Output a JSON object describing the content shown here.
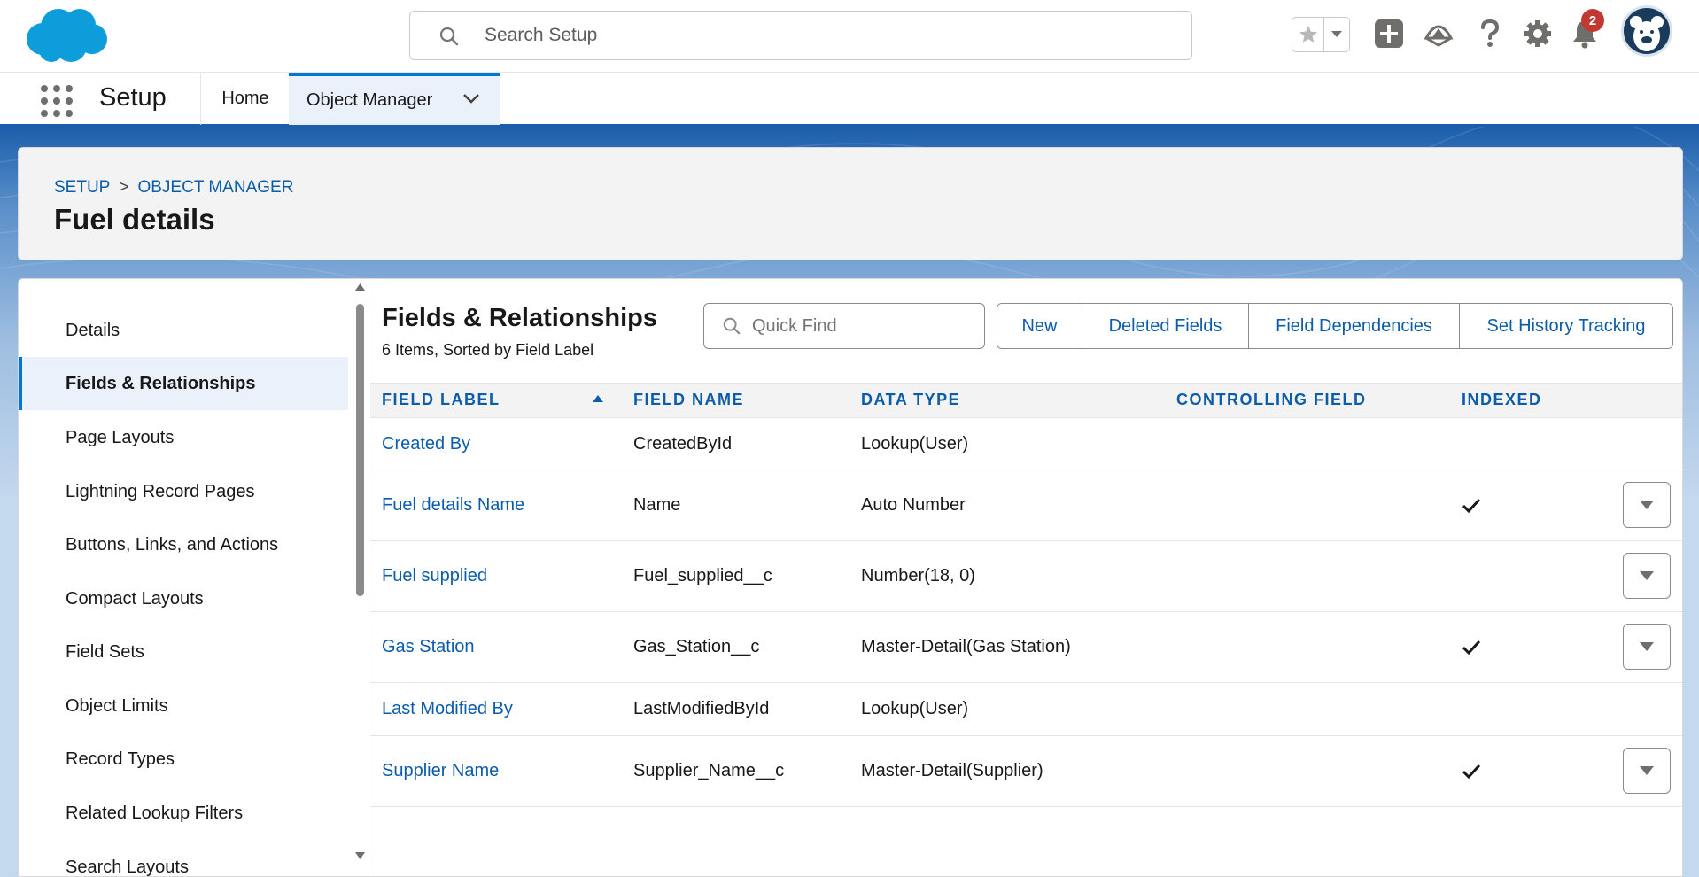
{
  "header": {
    "search_placeholder": "Search Setup",
    "notification_count": "2"
  },
  "nav": {
    "app_name": "Setup",
    "tabs": [
      {
        "label": "Home"
      },
      {
        "label": "Object Manager"
      }
    ]
  },
  "page_header": {
    "breadcrumb": [
      "SETUP",
      "OBJECT MANAGER"
    ],
    "breadcrumb_separator": ">",
    "title": "Fuel details"
  },
  "sidebar": {
    "items": [
      {
        "label": "Details"
      },
      {
        "label": "Fields & Relationships"
      },
      {
        "label": "Page Layouts"
      },
      {
        "label": "Lightning Record Pages"
      },
      {
        "label": "Buttons, Links, and Actions"
      },
      {
        "label": "Compact Layouts"
      },
      {
        "label": "Field Sets"
      },
      {
        "label": "Object Limits"
      },
      {
        "label": "Record Types"
      },
      {
        "label": "Related Lookup Filters"
      },
      {
        "label": "Search Layouts"
      }
    ],
    "active": "Fields & Relationships"
  },
  "content": {
    "title": "Fields & Relationships",
    "subtitle": "6 Items, Sorted by Field Label",
    "quick_find_placeholder": "Quick Find",
    "buttons": [
      "New",
      "Deleted Fields",
      "Field Dependencies",
      "Set History Tracking"
    ],
    "columns": [
      "FIELD LABEL",
      "FIELD NAME",
      "DATA TYPE",
      "CONTROLLING FIELD",
      "INDEXED"
    ],
    "rows": [
      {
        "label": "Created By",
        "name": "CreatedById",
        "type": "Lookup(User)",
        "controlling": "",
        "indexed": false,
        "menu": false
      },
      {
        "label": "Fuel details Name",
        "name": "Name",
        "type": "Auto Number",
        "controlling": "",
        "indexed": true,
        "menu": true
      },
      {
        "label": "Fuel supplied",
        "name": "Fuel_supplied__c",
        "type": "Number(18, 0)",
        "controlling": "",
        "indexed": false,
        "menu": true
      },
      {
        "label": "Gas Station",
        "name": "Gas_Station__c",
        "type": "Master-Detail(Gas Station)",
        "controlling": "",
        "indexed": true,
        "menu": true
      },
      {
        "label": "Last Modified By",
        "name": "LastModifiedById",
        "type": "Lookup(User)",
        "controlling": "",
        "indexed": false,
        "menu": false
      },
      {
        "label": "Supplier Name",
        "name": "Supplier_Name__c",
        "type": "Master-Detail(Supplier)",
        "controlling": "",
        "indexed": true,
        "menu": true
      }
    ]
  },
  "colors": {
    "brand_blue": "#0176d3",
    "link_blue": "#0b5cab",
    "badge_red": "#c23934"
  },
  "icons": [
    "salesforce-cloud-logo",
    "search-icon",
    "star-icon",
    "add-icon",
    "trailhead-icon",
    "help-icon",
    "gear-icon",
    "bell-icon",
    "avatar",
    "app-launcher-icon",
    "chevron-down-icon",
    "check-icon",
    "sort-ascending-icon"
  ]
}
